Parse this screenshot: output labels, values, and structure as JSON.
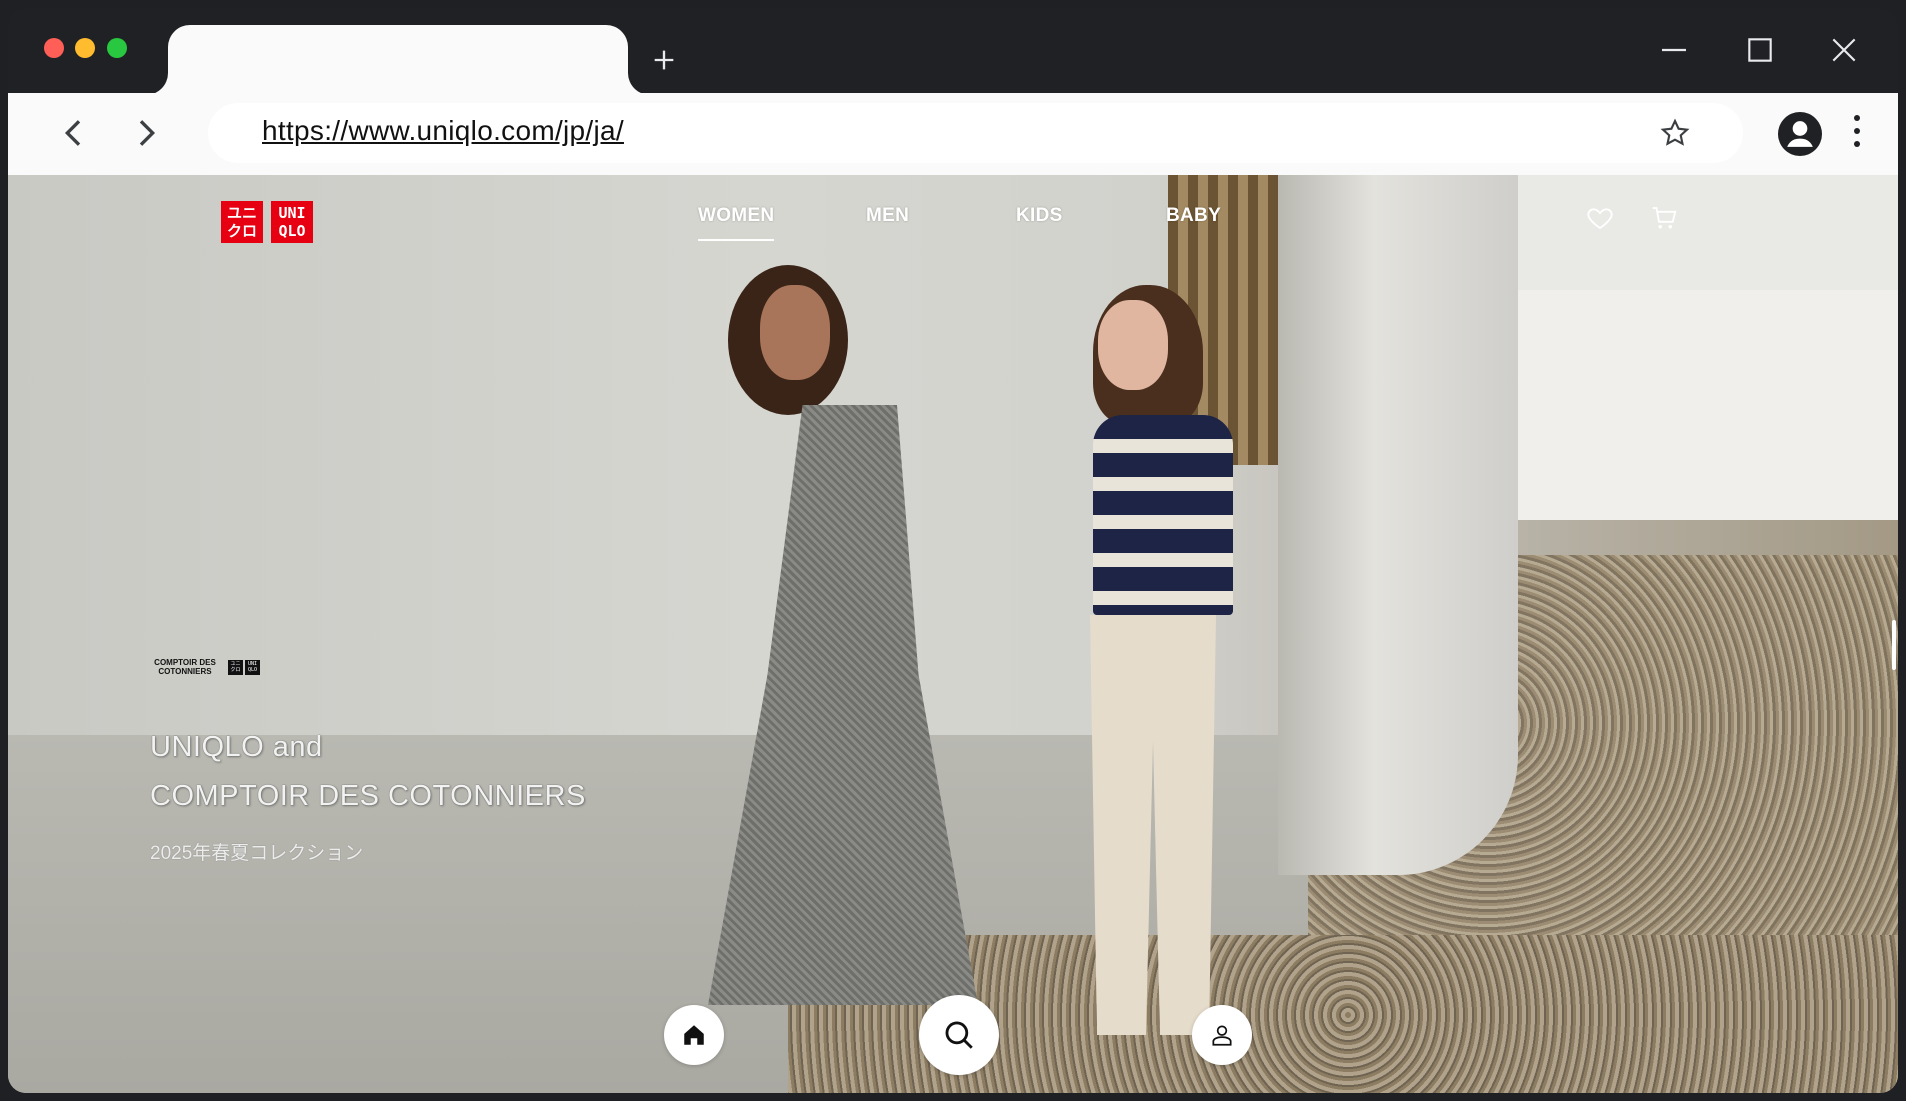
{
  "browser": {
    "tab_title": "",
    "url": "https://www.uniqlo.com/jp/ja/",
    "icons": {
      "back": "chevron-left-icon",
      "forward": "chevron-right-icon",
      "new_tab": "plus-icon",
      "bookmark": "star-icon",
      "profile": "account-circle-icon",
      "menu": "kebab-menu-icon",
      "minimize": "minimize-icon",
      "maximize": "maximize-icon",
      "close": "close-icon"
    },
    "colors": {
      "frame": "#202124",
      "toolbar": "#fafafa"
    }
  },
  "site": {
    "logo": {
      "top": "ユニ\nクロ",
      "bottom": "UNI\nQLO"
    },
    "nav": [
      {
        "label": "WOMEN",
        "active": true
      },
      {
        "label": "MEN",
        "active": false
      },
      {
        "label": "KIDS",
        "active": false
      },
      {
        "label": "BABY",
        "active": false
      }
    ],
    "header_icons": [
      "heart-icon",
      "cart-icon"
    ],
    "brand_color": "#e60012"
  },
  "hero": {
    "collab_brand": "COMPTOIR DES\nCOTONNIERS",
    "headline_line1": "UNIQLO and",
    "headline_line2": "COMPTOIR DES COTONNIERS",
    "subline": "2025年春夏コレクション"
  },
  "bottom_bar": {
    "buttons": [
      "home-icon",
      "search-icon",
      "account-icon"
    ]
  }
}
